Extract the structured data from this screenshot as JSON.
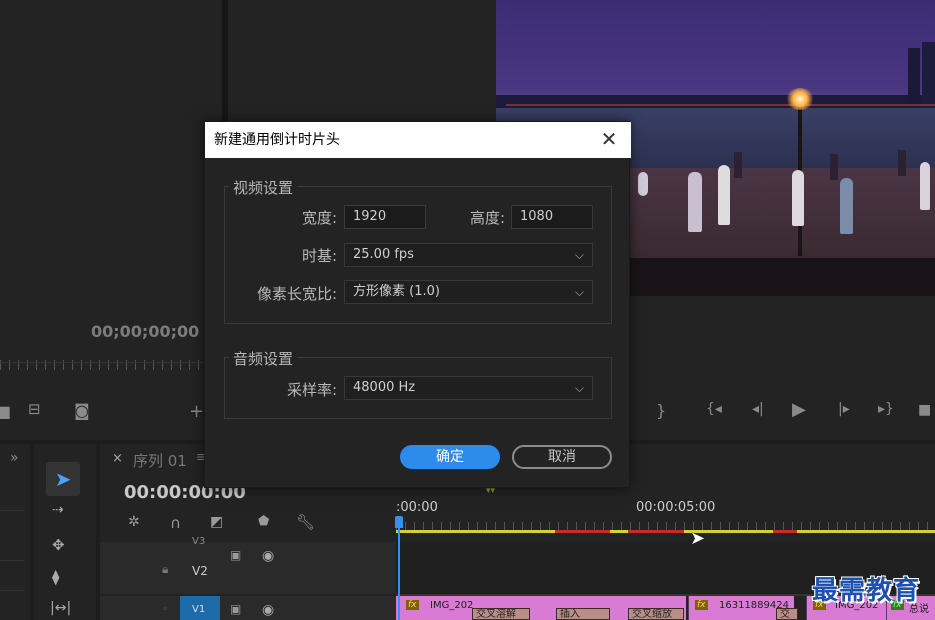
{
  "source_monitor": {
    "timecode": "00;00;00;00"
  },
  "dialog": {
    "title": "新建通用倒计时片头",
    "video_group": "视频设置",
    "width_label": "宽度:",
    "width_value": "1920",
    "height_label": "高度:",
    "height_value": "1080",
    "timebase_label": "时基:",
    "timebase_value": "25.00 fps",
    "pixel_aspect_label": "像素长宽比:",
    "pixel_aspect_value": "方形像素 (1.0)",
    "audio_group": "音频设置",
    "sample_rate_label": "采样率:",
    "sample_rate_value": "48000 Hz",
    "ok_label": "确定",
    "cancel_label": "取消"
  },
  "timeline": {
    "tab_close": "×",
    "tab_label": "序列 01",
    "tab_menu": "≡",
    "timecode": "00:00:00:00",
    "ruler_start": ":00:00",
    "ruler_mid": "00:00:05:00",
    "tracks": [
      {
        "name": "V3"
      },
      {
        "name": "V2"
      },
      {
        "name": "V1"
      }
    ],
    "clips": [
      {
        "label": "IMG_202"
      },
      {
        "label": "16311889424"
      },
      {
        "label": "IMG_202"
      },
      {
        "label": "总说"
      }
    ],
    "transitions": [
      "交叉溶解",
      "插入",
      "交叉缩放",
      "交"
    ]
  },
  "watermark": "最需教育",
  "colors": {
    "accent": "#2d8ceb",
    "clip": "#d97bd4",
    "playhead": "#3a8ef0"
  }
}
